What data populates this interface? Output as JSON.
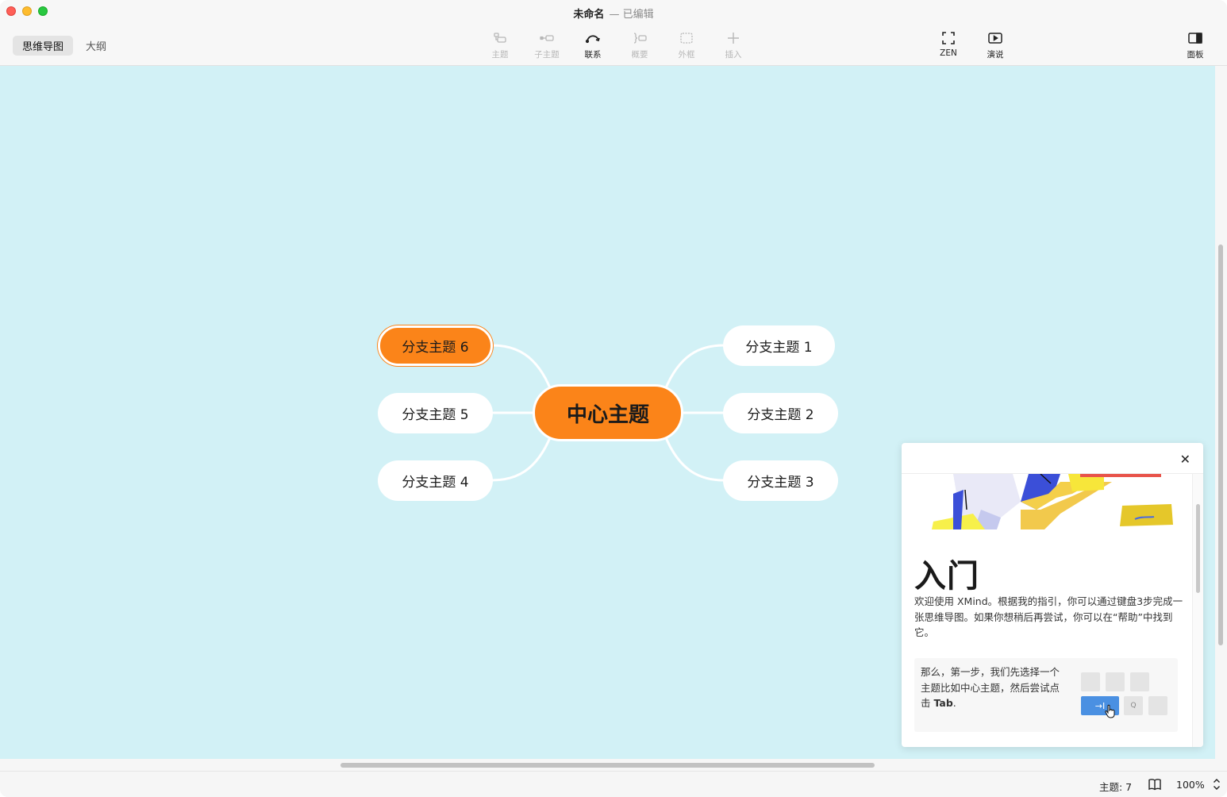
{
  "window": {
    "title": "未命名",
    "subtitle": "— 已编辑"
  },
  "view_tabs": [
    {
      "label": "思维导图",
      "active": true
    },
    {
      "label": "大纲",
      "active": false
    }
  ],
  "toolbar": {
    "topic": {
      "label": "主题",
      "icon": "topic-icon",
      "enabled": false
    },
    "subtopic": {
      "label": "子主题",
      "icon": "subtopic-icon",
      "enabled": false
    },
    "relationship": {
      "label": "联系",
      "icon": "relationship-icon",
      "enabled": true
    },
    "summary": {
      "label": "概要",
      "icon": "summary-icon",
      "enabled": false
    },
    "boundary": {
      "label": "外框",
      "icon": "boundary-icon",
      "enabled": false
    },
    "insert": {
      "label": "插入",
      "icon": "plus-icon",
      "enabled": false
    },
    "zen": {
      "label": "ZEN",
      "icon": "fullscreen-icon",
      "enabled": true
    },
    "present": {
      "label": "演说",
      "icon": "play-icon",
      "enabled": true
    },
    "panel": {
      "label": "面板",
      "icon": "sidebar-icon",
      "enabled": true
    }
  },
  "mindmap": {
    "center": "中心主题",
    "branches": [
      {
        "label": "分支主题 1",
        "selected": false
      },
      {
        "label": "分支主题 2",
        "selected": false
      },
      {
        "label": "分支主题 3",
        "selected": false
      },
      {
        "label": "分支主题 4",
        "selected": false
      },
      {
        "label": "分支主题 5",
        "selected": false
      },
      {
        "label": "分支主题 6",
        "selected": true
      }
    ],
    "colors": {
      "canvas": "#d2f1f6",
      "accent": "#fb8419",
      "node": "#ffffff",
      "line": "#ffffff"
    }
  },
  "help_panel": {
    "heading": "入门",
    "intro": "欢迎使用 XMind。根据我的指引，你可以通过键盘3步完成一张思维导图。如果你想稍后再尝试，你可以在“帮助”中找到它。",
    "step_text": "那么，第一步，我们先选择一个主题比如中心主题，然后尝试点击 ",
    "step_key": "Tab",
    "step_end": ".",
    "tab_key_glyph": "→I",
    "q_key_glyph": "Q"
  },
  "status": {
    "topic_count": "主题: 7",
    "zoom": "100%"
  }
}
